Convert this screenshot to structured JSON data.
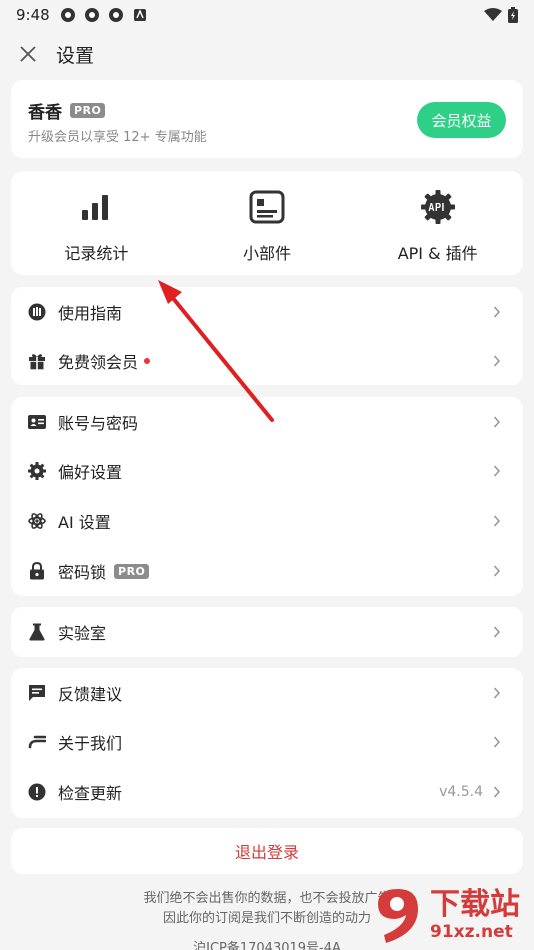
{
  "status_bar": {
    "time": "9:48"
  },
  "header": {
    "title": "设置"
  },
  "profile": {
    "name": "香香",
    "badge": "PRO",
    "subtitle": "升级会员以享受 12+ 专属功能",
    "member_button": "会员权益"
  },
  "shortcuts": [
    {
      "label": "记录统计",
      "icon": "bar-chart-icon"
    },
    {
      "label": "小部件",
      "icon": "widget-icon"
    },
    {
      "label": "API & 插件",
      "icon": "api-gear-icon"
    }
  ],
  "group1": [
    {
      "label": "使用指南",
      "icon": "guide-icon"
    },
    {
      "label": "免费领会员",
      "icon": "gift-icon"
    }
  ],
  "group2": [
    {
      "label": "账号与密码",
      "icon": "id-card-icon"
    },
    {
      "label": "偏好设置",
      "icon": "gear-icon"
    },
    {
      "label": "AI 设置",
      "icon": "atom-icon"
    },
    {
      "label": "密码锁",
      "icon": "lock-icon",
      "badge": "PRO"
    }
  ],
  "group3": [
    {
      "label": "实验室",
      "icon": "flask-icon"
    }
  ],
  "group4": [
    {
      "label": "反馈建议",
      "icon": "feedback-icon"
    },
    {
      "label": "关于我们",
      "icon": "about-icon"
    },
    {
      "label": "检查更新",
      "icon": "alert-icon",
      "value": "v4.5.4"
    }
  ],
  "logout": {
    "label": "退出登录"
  },
  "footer": {
    "line1": "我们绝不会出售你的数据，也不会投放广告",
    "line2": "因此你的订阅是我们不断创造的动力",
    "line3": "沪ICP备17043019号-4A"
  },
  "watermark": {
    "title": "下载站",
    "url": "91xz.net"
  },
  "colors": {
    "accent_green": "#2ecf86",
    "danger_red": "#d63b3b",
    "arrow_red": "#e02020"
  }
}
